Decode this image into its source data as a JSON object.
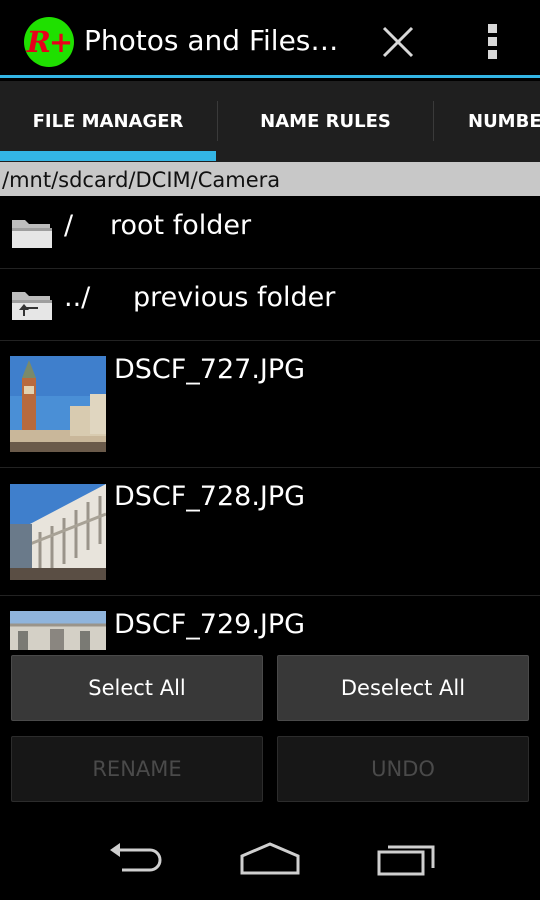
{
  "app": {
    "icon_text": "R+",
    "title": "Photos and Files…"
  },
  "actions": {
    "close_icon": "close-icon",
    "overflow_icon": "overflow-menu-icon"
  },
  "tabs": [
    {
      "label": "FILE MANAGER",
      "selected": true
    },
    {
      "label": "NAME RULES",
      "selected": false
    },
    {
      "label": "NUMBER",
      "selected": false
    }
  ],
  "path": "/mnt/sdcard/DCIM/Camera",
  "entries": [
    {
      "type": "folder",
      "icon": "folder-icon",
      "name": "/",
      "description": "root folder"
    },
    {
      "type": "folder",
      "icon": "folder-up-icon",
      "name": "../",
      "description": "previous folder"
    },
    {
      "type": "file",
      "name": "DSCF_727.JPG"
    },
    {
      "type": "file",
      "name": "DSCF_728.JPG"
    },
    {
      "type": "file",
      "name": "DSCF_729.JPG"
    }
  ],
  "buttons": {
    "select_all": "Select All",
    "deselect_all": "Deselect All",
    "rename": "RENAME",
    "undo": "UNDO"
  },
  "colors": {
    "accent": "#33b5e5",
    "app_icon_bg": "#1fe000",
    "app_icon_fg": "#e8001a"
  }
}
